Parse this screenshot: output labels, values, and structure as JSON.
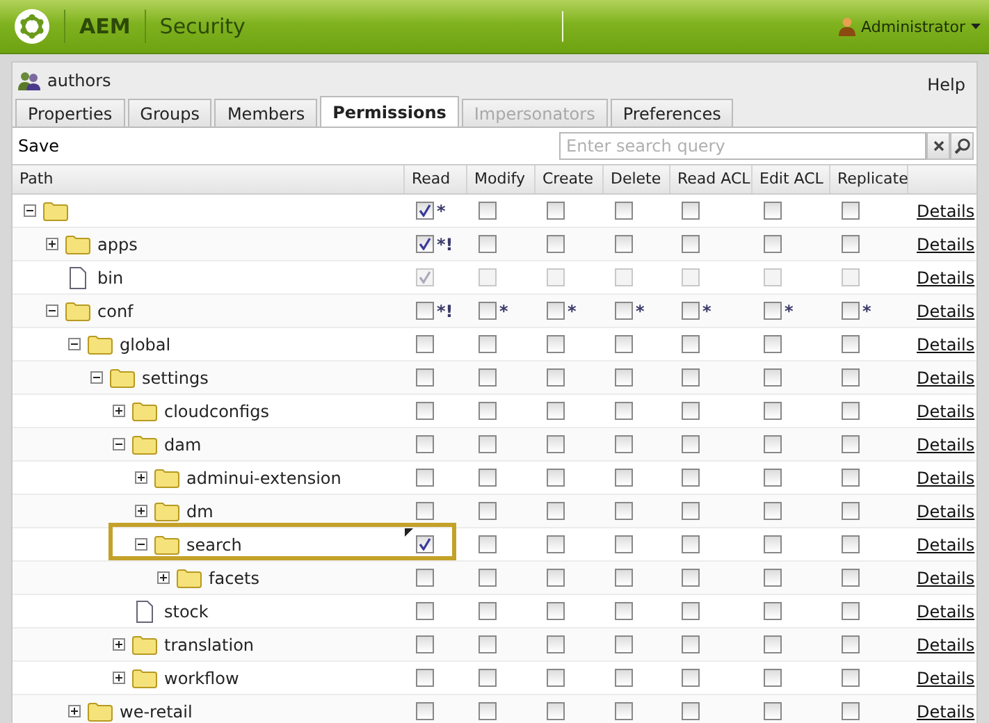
{
  "header": {
    "product": "AEM",
    "section": "Security",
    "user": "Administrator"
  },
  "panel": {
    "group": "authors",
    "help": "Help",
    "tabs": [
      {
        "label": "Properties",
        "selected": false,
        "disabled": false
      },
      {
        "label": "Groups",
        "selected": false,
        "disabled": false
      },
      {
        "label": "Members",
        "selected": false,
        "disabled": false
      },
      {
        "label": "Permissions",
        "selected": true,
        "disabled": false
      },
      {
        "label": "Impersonators",
        "selected": false,
        "disabled": true
      },
      {
        "label": "Preferences",
        "selected": false,
        "disabled": false
      }
    ],
    "save": "Save",
    "search": {
      "placeholder": "Enter search query"
    }
  },
  "table": {
    "columns": [
      "Path",
      "Read",
      "Modify",
      "Create",
      "Delete",
      "Read ACL",
      "Edit ACL",
      "Replicate"
    ],
    "rows": [
      {
        "kind": "folder",
        "expanded": true,
        "details": "Details",
        "perms": [
          {
            "checked": true,
            "mark": "*"
          },
          {
            "checked": false
          },
          {
            "checked": false
          },
          {
            "checked": false
          },
          {
            "checked": false
          },
          {
            "checked": false
          },
          {
            "checked": false
          }
        ],
        "children": [
          {
            "name": "apps",
            "kind": "folder",
            "expanded": false,
            "details": "Details",
            "perms": [
              {
                "checked": true,
                "mark": "*!"
              },
              {
                "checked": false
              },
              {
                "checked": false
              },
              {
                "checked": false
              },
              {
                "checked": false
              },
              {
                "checked": false
              },
              {
                "checked": false
              }
            ]
          },
          {
            "name": "bin",
            "kind": "page",
            "disabled": true,
            "details": "Details",
            "perms": [
              {
                "checked": true
              },
              {
                "checked": false
              },
              {
                "checked": false
              },
              {
                "checked": false
              },
              {
                "checked": false
              },
              {
                "checked": false
              },
              {
                "checked": false
              }
            ]
          },
          {
            "name": "conf",
            "kind": "folder",
            "expanded": true,
            "details": "Details",
            "perms": [
              {
                "checked": false,
                "mark": "*!"
              },
              {
                "checked": false,
                "mark": "*"
              },
              {
                "checked": false,
                "mark": "*"
              },
              {
                "checked": false,
                "mark": "*"
              },
              {
                "checked": false,
                "mark": "*"
              },
              {
                "checked": false,
                "mark": "*"
              },
              {
                "checked": false,
                "mark": "*"
              }
            ],
            "children": [
              {
                "name": "global",
                "kind": "folder",
                "expanded": true,
                "details": "Details",
                "perms": [
                  {
                    "checked": false
                  },
                  {
                    "checked": false
                  },
                  {
                    "checked": false
                  },
                  {
                    "checked": false
                  },
                  {
                    "checked": false
                  },
                  {
                    "checked": false
                  },
                  {
                    "checked": false
                  }
                ],
                "children": [
                  {
                    "name": "settings",
                    "kind": "folder",
                    "expanded": true,
                    "details": "Details",
                    "perms": [
                      {
                        "checked": false
                      },
                      {
                        "checked": false
                      },
                      {
                        "checked": false
                      },
                      {
                        "checked": false
                      },
                      {
                        "checked": false
                      },
                      {
                        "checked": false
                      },
                      {
                        "checked": false
                      }
                    ],
                    "children": [
                      {
                        "name": "cloudconfigs",
                        "kind": "folder",
                        "expanded": false,
                        "details": "Details",
                        "perms": [
                          {
                            "checked": false
                          },
                          {
                            "checked": false
                          },
                          {
                            "checked": false
                          },
                          {
                            "checked": false
                          },
                          {
                            "checked": false
                          },
                          {
                            "checked": false
                          },
                          {
                            "checked": false
                          }
                        ]
                      },
                      {
                        "name": "dam",
                        "kind": "folder",
                        "expanded": true,
                        "details": "Details",
                        "perms": [
                          {
                            "checked": false
                          },
                          {
                            "checked": false
                          },
                          {
                            "checked": false
                          },
                          {
                            "checked": false
                          },
                          {
                            "checked": false
                          },
                          {
                            "checked": false
                          },
                          {
                            "checked": false
                          }
                        ],
                        "children": [
                          {
                            "name": "adminui-extension",
                            "kind": "folder",
                            "expanded": false,
                            "details": "Details",
                            "perms": [
                              {
                                "checked": false
                              },
                              {
                                "checked": false
                              },
                              {
                                "checked": false
                              },
                              {
                                "checked": false
                              },
                              {
                                "checked": false
                              },
                              {
                                "checked": false
                              },
                              {
                                "checked": false
                              }
                            ]
                          },
                          {
                            "name": "dm",
                            "kind": "folder",
                            "expanded": false,
                            "details": "Details",
                            "perms": [
                              {
                                "checked": false
                              },
                              {
                                "checked": false
                              },
                              {
                                "checked": false
                              },
                              {
                                "checked": false
                              },
                              {
                                "checked": false
                              },
                              {
                                "checked": false
                              },
                              {
                                "checked": false
                              }
                            ]
                          },
                          {
                            "name": "search",
                            "kind": "folder",
                            "expanded": true,
                            "highlighted": true,
                            "details": "Details",
                            "perms": [
                              {
                                "checked": true,
                                "changed": true
                              },
                              {
                                "checked": false
                              },
                              {
                                "checked": false
                              },
                              {
                                "checked": false
                              },
                              {
                                "checked": false
                              },
                              {
                                "checked": false
                              },
                              {
                                "checked": false
                              }
                            ],
                            "children": [
                              {
                                "name": "facets",
                                "kind": "folder",
                                "expanded": false,
                                "details": "Details",
                                "perms": [
                                  {
                                    "checked": false
                                  },
                                  {
                                    "checked": false
                                  },
                                  {
                                    "checked": false
                                  },
                                  {
                                    "checked": false
                                  },
                                  {
                                    "checked": false
                                  },
                                  {
                                    "checked": false
                                  },
                                  {
                                    "checked": false
                                  }
                                ]
                              }
                            ]
                          }
                        ]
                      },
                      {
                        "name": "stock",
                        "kind": "page",
                        "details": "Details",
                        "perms": [
                          {
                            "checked": false
                          },
                          {
                            "checked": false
                          },
                          {
                            "checked": false
                          },
                          {
                            "checked": false
                          },
                          {
                            "checked": false
                          },
                          {
                            "checked": false
                          },
                          {
                            "checked": false
                          }
                        ]
                      },
                      {
                        "name": "translation",
                        "kind": "folder",
                        "expanded": false,
                        "details": "Details",
                        "perms": [
                          {
                            "checked": false
                          },
                          {
                            "checked": false
                          },
                          {
                            "checked": false
                          },
                          {
                            "checked": false
                          },
                          {
                            "checked": false
                          },
                          {
                            "checked": false
                          },
                          {
                            "checked": false
                          }
                        ]
                      },
                      {
                        "name": "workflow",
                        "kind": "folder",
                        "expanded": false,
                        "details": "Details",
                        "perms": [
                          {
                            "checked": false
                          },
                          {
                            "checked": false
                          },
                          {
                            "checked": false
                          },
                          {
                            "checked": false
                          },
                          {
                            "checked": false
                          },
                          {
                            "checked": false
                          },
                          {
                            "checked": false
                          }
                        ]
                      }
                    ]
                  }
                ]
              },
              {
                "name": "we-retail",
                "kind": "folder",
                "expanded": false,
                "details": "Details",
                "perms": [
                  {
                    "checked": false
                  },
                  {
                    "checked": false
                  },
                  {
                    "checked": false
                  },
                  {
                    "checked": false
                  },
                  {
                    "checked": false
                  },
                  {
                    "checked": false
                  },
                  {
                    "checked": false
                  }
                ]
              }
            ]
          }
        ]
      }
    ]
  }
}
